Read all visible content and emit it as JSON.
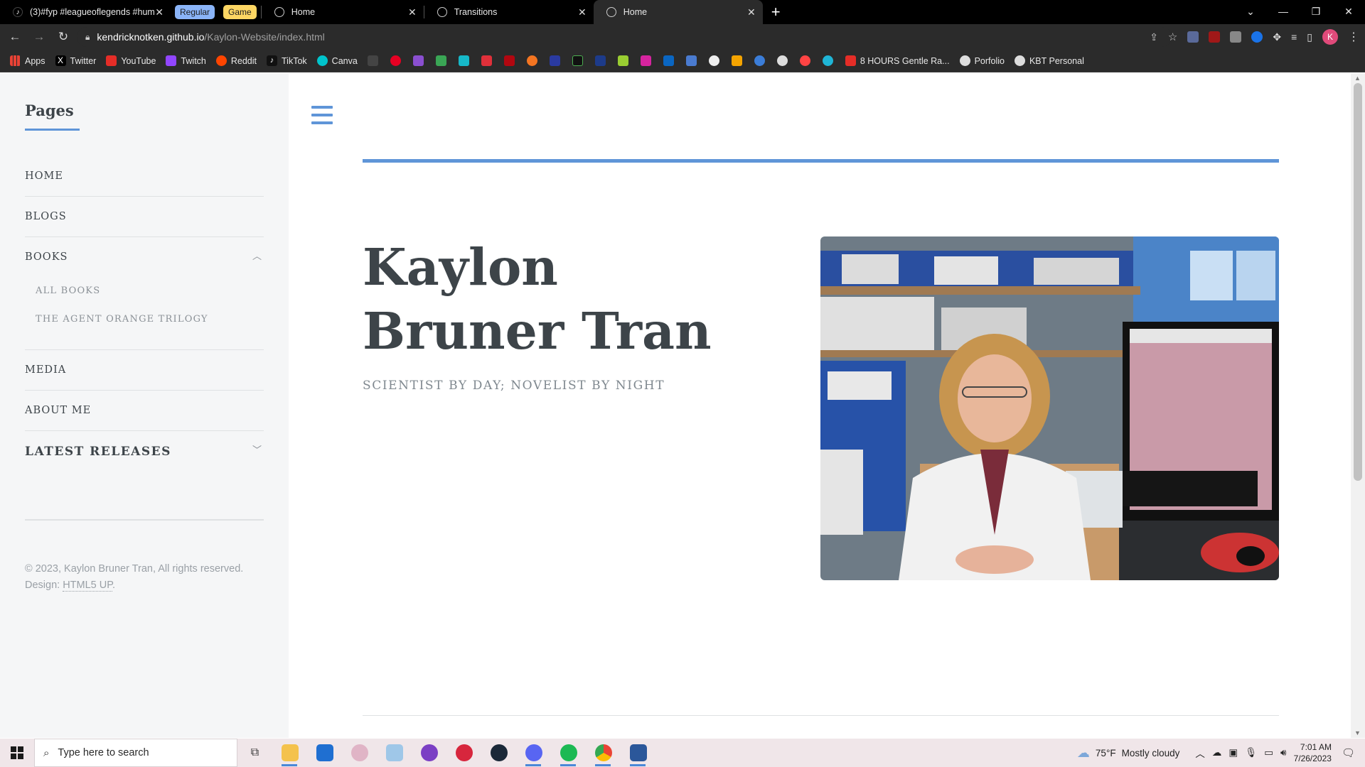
{
  "browser": {
    "tabs": [
      {
        "title": "(3)#fyp #leagueoflegends #hum",
        "icon": "tiktok-icon"
      },
      {
        "group": "Regular",
        "color": "#8ab4f8"
      },
      {
        "group": "Game",
        "color": "#fdd663"
      },
      {
        "title": "Home",
        "icon": "globe-icon"
      },
      {
        "title": "Transitions",
        "icon": "globe-icon"
      },
      {
        "title": "Home",
        "icon": "globe-icon",
        "active": true
      }
    ],
    "url_host": "kendricknotken.github.io",
    "url_path": "/Kaylon-Website/index.html",
    "bookmarks": {
      "apps": "Apps",
      "twitter": "Twitter",
      "youtube": "YouTube",
      "twitch": "Twitch",
      "reddit": "Reddit",
      "tiktok": "TikTok",
      "canva": "Canva",
      "gentle_rain": "8 HOURS Gentle Ra...",
      "porfolio": "Porfolio",
      "kbt_personal": "KBT Personal"
    },
    "profile_initial": "K"
  },
  "sidebar": {
    "title": "Pages",
    "nav": {
      "home": "HOME",
      "blogs": "BLOGS",
      "books": "BOOKS",
      "all_books": "ALL BOOKS",
      "agent_orange": "THE AGENT ORANGE TRILOGY",
      "media": "MEDIA",
      "about": "ABOUT ME"
    },
    "latest_releases": "LATEST RELEASES",
    "footer": {
      "copyright": "© 2023, Kaylon Bruner Tran, All rights reserved.",
      "design_label": "Design:",
      "design_link": "HTML5 UP"
    }
  },
  "main": {
    "name": "Kaylon Bruner Tran",
    "tagline": "SCIENTIST BY DAY; NOVELIST BY NIGHT"
  },
  "taskbar": {
    "search_placeholder": "Type here to search",
    "weather_temp": "75°F",
    "weather_desc": "Mostly cloudy",
    "time": "7:01 AM",
    "date": "7/26/2023"
  },
  "colors": {
    "accent": "#5f95d8",
    "heading": "#3d4449",
    "sidebar_bg": "#f5f6f7"
  }
}
